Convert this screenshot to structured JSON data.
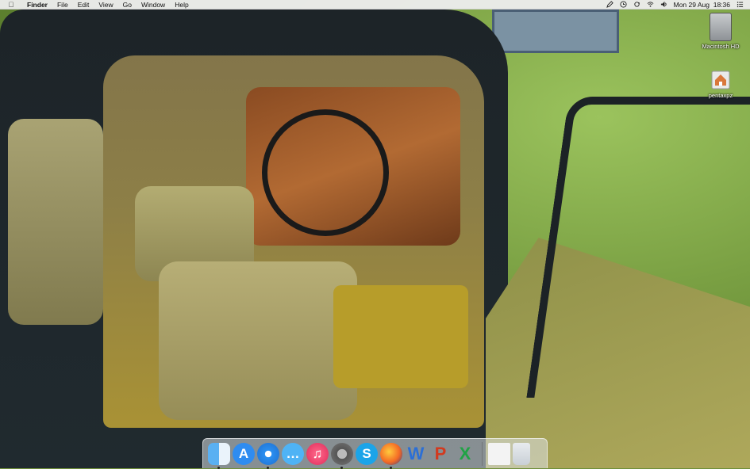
{
  "menubar": {
    "apple_icon": "apple-logo-icon",
    "app_name": "Finder",
    "menus": [
      "File",
      "Edit",
      "View",
      "Go",
      "Window",
      "Help"
    ],
    "status_icons": [
      "pen-icon",
      "time-machine-icon",
      "sync-icon",
      "wifi-icon",
      "volume-icon"
    ],
    "clock": "Mon 29 Aug  18:36",
    "list_icon": "notification-list-icon"
  },
  "desktop": {
    "icons": [
      {
        "label": "Macintosh HD",
        "icon": "hard-drive-icon"
      },
      {
        "label": "pentaxpz",
        "icon": "home-folder-icon"
      }
    ]
  },
  "dock": {
    "items": [
      {
        "name": "Finder",
        "icon": "finder-icon",
        "running": true
      },
      {
        "name": "App Store",
        "icon": "app-store-icon",
        "running": false
      },
      {
        "name": "Safari",
        "icon": "safari-icon",
        "running": true
      },
      {
        "name": "Messages",
        "icon": "messages-icon",
        "running": false
      },
      {
        "name": "iTunes",
        "icon": "itunes-icon",
        "running": false
      },
      {
        "name": "System Preferences",
        "icon": "system-preferences-icon",
        "running": true
      },
      {
        "name": "Skype",
        "icon": "skype-icon",
        "running": false,
        "glyph": "S"
      },
      {
        "name": "Firefox",
        "icon": "firefox-icon",
        "running": true
      },
      {
        "name": "Word",
        "icon": "word-icon",
        "running": false,
        "glyph": "W"
      },
      {
        "name": "PowerPoint",
        "icon": "powerpoint-icon",
        "running": false,
        "glyph": "P"
      },
      {
        "name": "Excel",
        "icon": "excel-icon",
        "running": false,
        "glyph": "X"
      },
      {
        "name": "Document",
        "icon": "document-icon",
        "running": false
      },
      {
        "name": "Trash",
        "icon": "trash-icon",
        "running": false
      }
    ]
  }
}
